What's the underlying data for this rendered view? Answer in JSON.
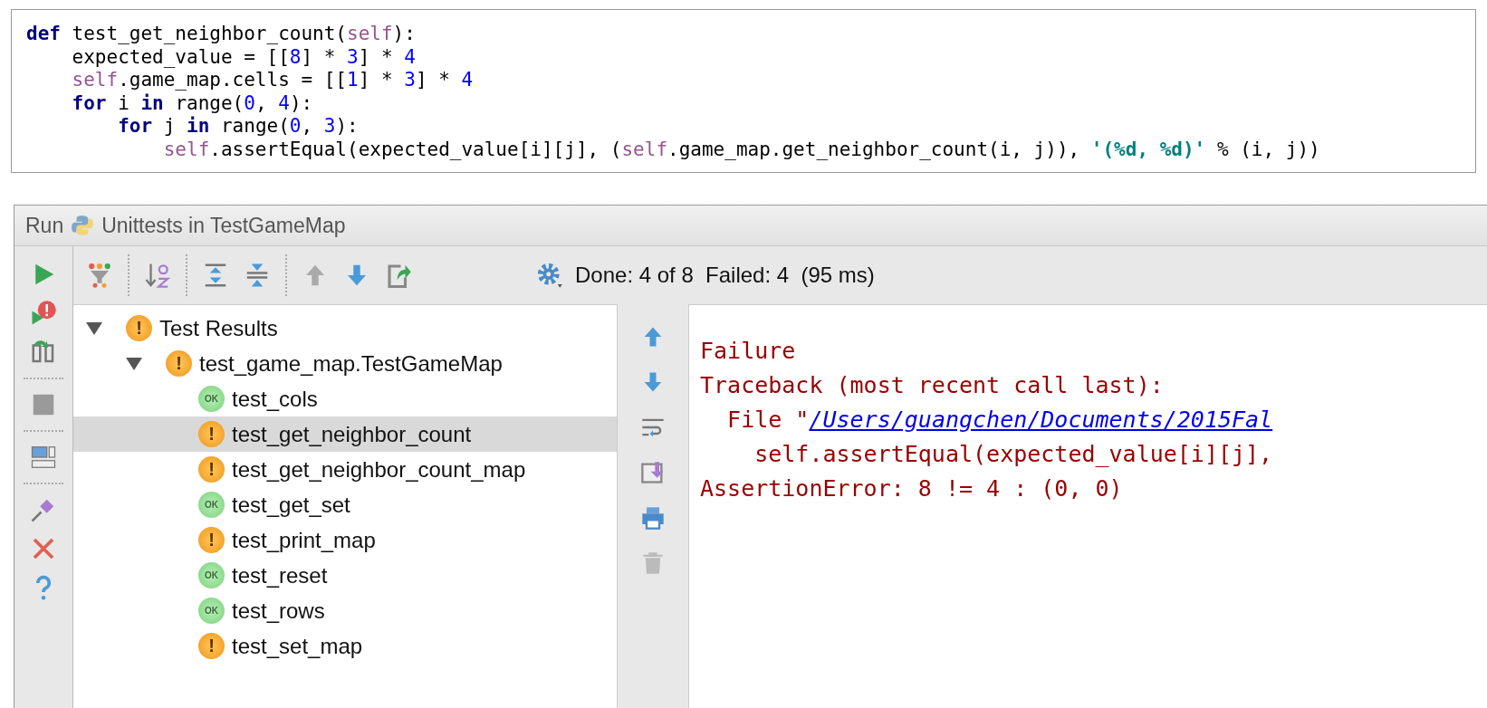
{
  "code": {
    "lines": [
      [
        {
          "kind": "keyword",
          "text": "def"
        },
        {
          "kind": "plain",
          "text": " test_get_neighbor_count("
        },
        {
          "kind": "self",
          "text": "self"
        },
        {
          "kind": "plain",
          "text": "):"
        }
      ],
      [
        {
          "kind": "plain",
          "text": "    expected_value = [["
        },
        {
          "kind": "number",
          "text": "8"
        },
        {
          "kind": "plain",
          "text": "] * "
        },
        {
          "kind": "number",
          "text": "3"
        },
        {
          "kind": "plain",
          "text": "] * "
        },
        {
          "kind": "number",
          "text": "4"
        }
      ],
      [
        {
          "kind": "self",
          "text": "    self"
        },
        {
          "kind": "plain",
          "text": ".game_map.cells = [["
        },
        {
          "kind": "number",
          "text": "1"
        },
        {
          "kind": "plain",
          "text": "] * "
        },
        {
          "kind": "number",
          "text": "3"
        },
        {
          "kind": "plain",
          "text": "] * "
        },
        {
          "kind": "number",
          "text": "4"
        }
      ],
      [
        {
          "kind": "keyword",
          "text": "    for"
        },
        {
          "kind": "plain",
          "text": " i "
        },
        {
          "kind": "keyword",
          "text": "in"
        },
        {
          "kind": "plain",
          "text": " range("
        },
        {
          "kind": "number",
          "text": "0"
        },
        {
          "kind": "plain",
          "text": ", "
        },
        {
          "kind": "number",
          "text": "4"
        },
        {
          "kind": "plain",
          "text": "):"
        }
      ],
      [
        {
          "kind": "keyword",
          "text": "        for"
        },
        {
          "kind": "plain",
          "text": " j "
        },
        {
          "kind": "keyword",
          "text": "in"
        },
        {
          "kind": "plain",
          "text": " range("
        },
        {
          "kind": "number",
          "text": "0"
        },
        {
          "kind": "plain",
          "text": ", "
        },
        {
          "kind": "number",
          "text": "3"
        },
        {
          "kind": "plain",
          "text": "):"
        }
      ],
      [
        {
          "kind": "self",
          "text": "            self"
        },
        {
          "kind": "plain",
          "text": ".assertEqual(expected_value[i][j], ("
        },
        {
          "kind": "self",
          "text": "self"
        },
        {
          "kind": "plain",
          "text": ".game_map.get_neighbor_count(i, j)), "
        },
        {
          "kind": "string",
          "text": "'(%d, %d)'"
        },
        {
          "kind": "plain",
          "text": " % (i, j))"
        }
      ]
    ]
  },
  "run_panel": {
    "label": "Run",
    "title": "Unittests in TestGameMap",
    "status": "Done: 4 of 8  Failed: 4  (95 ms)",
    "tree": {
      "label": "Test Results",
      "kind": "fail",
      "badge": "!",
      "expanded": true,
      "children": [
        {
          "label": "test_game_map.TestGameMap",
          "kind": "fail",
          "badge": "!",
          "expanded": true,
          "children": [
            {
              "label": "test_cols",
              "kind": "ok",
              "badge": "OK",
              "selected": false
            },
            {
              "label": "test_get_neighbor_count",
              "kind": "fail",
              "badge": "!",
              "selected": true
            },
            {
              "label": "test_get_neighbor_count_map",
              "kind": "fail",
              "badge": "!",
              "selected": false
            },
            {
              "label": "test_get_set",
              "kind": "ok",
              "badge": "OK",
              "selected": false
            },
            {
              "label": "test_print_map",
              "kind": "fail",
              "badge": "!",
              "selected": false
            },
            {
              "label": "test_reset",
              "kind": "ok",
              "badge": "OK",
              "selected": false
            },
            {
              "label": "test_rows",
              "kind": "ok",
              "badge": "OK",
              "selected": false
            },
            {
              "label": "test_set_map",
              "kind": "fail",
              "badge": "!",
              "selected": false
            }
          ]
        }
      ]
    },
    "console": [
      {
        "text": "Failure"
      },
      {
        "text": "Traceback (most recent call last):"
      },
      {
        "text": "  File \"",
        "link": "/Users/guangchen/Documents/2015Fal"
      },
      {
        "text": "    self.assertEqual(expected_value[i][j],"
      },
      {
        "text": "AssertionError: 8 != 4 : (0, 0)"
      }
    ]
  }
}
